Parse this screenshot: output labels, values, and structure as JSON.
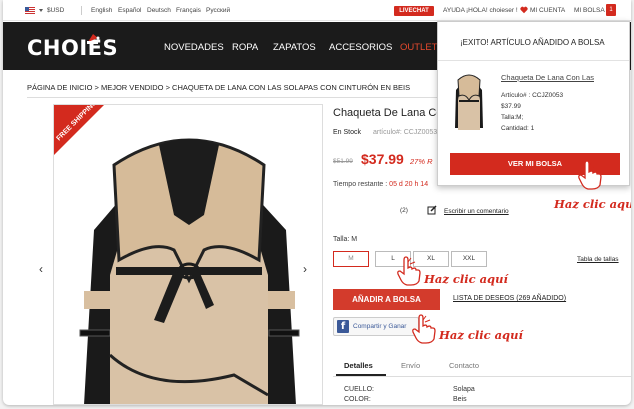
{
  "topbar": {
    "currency": "$USD",
    "languages": [
      "English",
      "Español",
      "Deutsch",
      "Français",
      "Русский"
    ],
    "livechat": "LIVECHAT",
    "help": "AYUDA",
    "greeting": "¡HOLA! choieser !",
    "account": "MI CUENTA",
    "bag": "MI BOLSA",
    "bag_count": "1"
  },
  "nav": {
    "logo": "CHOIES",
    "items": [
      "NOVEDADES",
      "ROPA",
      "ZAPATOS",
      "ACCESORIOS",
      "OUTLET"
    ]
  },
  "breadcrumb": "PÁGINA DE INICIO > MEJOR VENDIDO > CHAQUETA DE LANA CON LAS SOLAPAS CON CINTURÓN EN BEIS",
  "product": {
    "ribbon": "FREE SHIPPING",
    "title": "Chaqueta De Lana Co",
    "stock": "En Stock",
    "sku": "artículo#: CCJZ0053",
    "old_price": "$51.99",
    "price": "$37.99",
    "discount": "27% R",
    "timer_label": "Tiempo restante :",
    "timer_value": "05 d 20 h 14",
    "review_count": "(2)",
    "write_review": "Escribir un comentario",
    "size_label": "Talla: M",
    "sizes": [
      "M",
      "L",
      "XL",
      "XXL"
    ],
    "selected_size": "M",
    "size_guide": "Tabla de tallas",
    "add_to_bag": "AÑADIR A BOLSA",
    "wishlist": "LISTA DE DESEOS (269 AÑADIDO)",
    "share": "Compartir y Ganar",
    "tabs": [
      "Detalles",
      "Envío",
      "Contacto"
    ],
    "specs": [
      {
        "key": "CUELLO:",
        "value": "Solapa"
      },
      {
        "key": "COLOR:",
        "value": "Beis"
      }
    ]
  },
  "popup": {
    "heading": "¡EXITO! ARTÍCULO AÑADIDO A BOLSA",
    "item_name": "Chaqueta De Lana Con Las",
    "item_sku": "Artículo# : CCJZ0053",
    "item_price": "$37.99",
    "item_size": "Talla:M;",
    "item_qty": "Cantidad: 1",
    "button": "VER MI BOLSA"
  },
  "annotations": {
    "click_here": "Haz clic aquí"
  },
  "colors": {
    "accent": "#d32a1e",
    "nav_bg": "#1b1b1b",
    "facebook": "#3b5998"
  }
}
